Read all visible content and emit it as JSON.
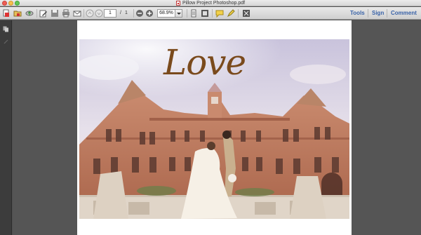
{
  "window": {
    "title": "Pillow Project Photoshop.pdf"
  },
  "toolbar": {
    "page_current": "1",
    "page_separator": "/",
    "page_total": "1",
    "zoom": "68.9%",
    "links": {
      "tools": "Tools",
      "sign": "Sign",
      "comment": "Comment"
    }
  },
  "document": {
    "overlay_text": "Love"
  },
  "colors": {
    "accent": "#3a63a8",
    "love_text": "#7a4a1c",
    "brick": "#b9735a",
    "sky": "#d9d6e6"
  },
  "icons": [
    "create-pdf-icon",
    "open-icon",
    "cloud-upload-icon",
    "edit-icon",
    "save-icon",
    "print-icon",
    "email-icon",
    "previous-page-icon",
    "next-page-icon",
    "zoom-out-icon",
    "zoom-in-icon",
    "fit-page-icon",
    "fit-width-icon",
    "comment-icon",
    "highlight-icon",
    "fullscreen-icon",
    "pages-panel-icon",
    "attachments-panel-icon"
  ]
}
